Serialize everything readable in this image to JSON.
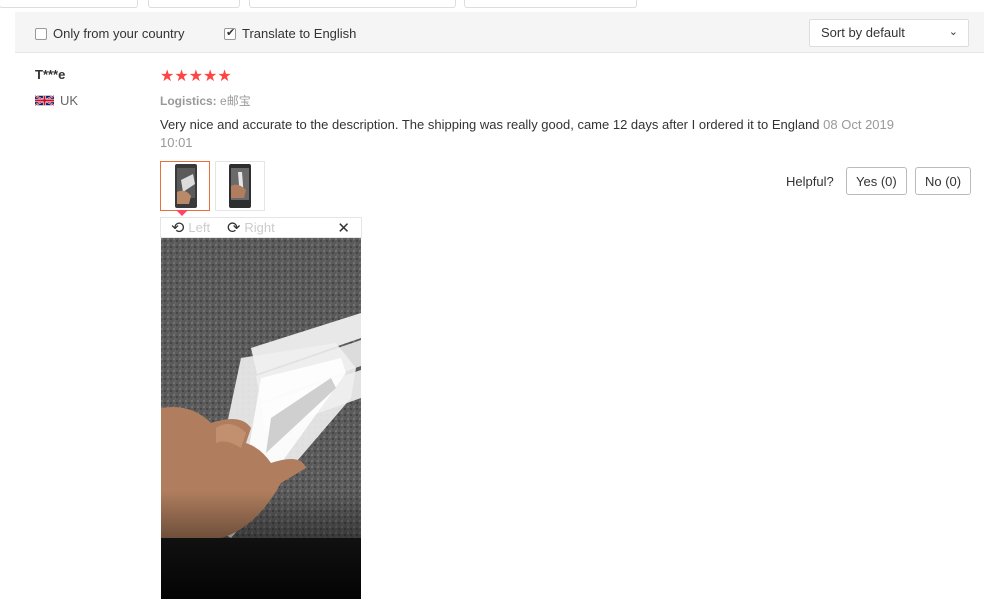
{
  "filters": {
    "only_country_label": "Only from your country",
    "only_country_checked": false,
    "translate_label": "Translate to English",
    "translate_checked": true,
    "sort_value": "Sort by default"
  },
  "review": {
    "reviewer_name": "T***e",
    "country": "UK",
    "stars": "★★★★★",
    "rating": 5,
    "logistics_label": "Logistics:",
    "logistics_value": "e邮宝",
    "text": "Very nice and accurate to the description. The shipping was really good, came 12 days after I ordered it to England",
    "date": "08 Oct 2019 10:01",
    "helpful_label": "Helpful?",
    "yes_label": "Yes (0)",
    "no_label": "No (0)"
  },
  "viewer": {
    "rotate_left_label": "Left",
    "rotate_right_label": "Right"
  },
  "colors": {
    "star": "#ff4444",
    "active_thumb_border": "#e96f3c",
    "filter_bg": "#f5f5f5"
  },
  "icons": {
    "rotate_left": "rotate-left-icon",
    "rotate_right": "rotate-right-icon",
    "close": "close-icon",
    "sort_chevron": "chevron-down-icon",
    "flag": "uk-flag-icon"
  }
}
